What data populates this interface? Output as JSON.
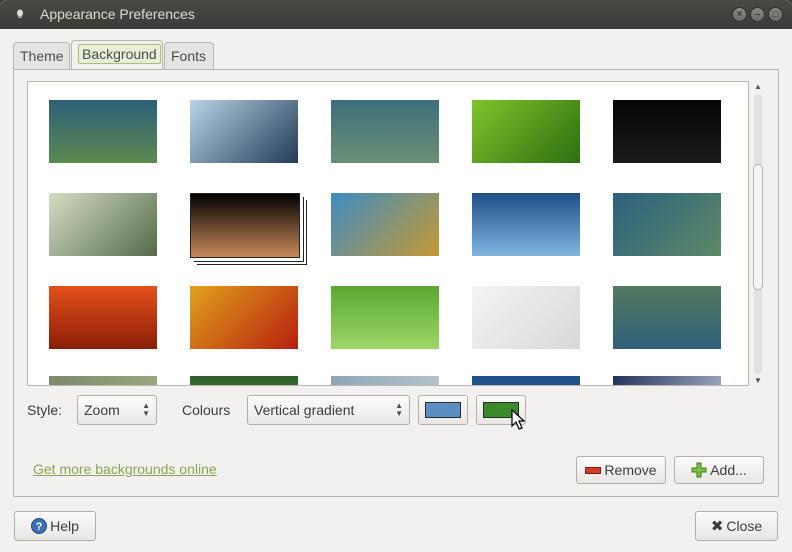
{
  "window": {
    "title": "Appearance Preferences",
    "controls": [
      "close",
      "minimize",
      "maximize"
    ]
  },
  "tabs": [
    {
      "label": "Theme",
      "active": false
    },
    {
      "label": "Background",
      "active": true
    },
    {
      "label": "Fonts",
      "active": false
    }
  ],
  "gallery": {
    "wallpapers": [
      {
        "name": "blue-green-gradient",
        "colors": [
          "#2e5f7a",
          "#5b8a4e"
        ]
      },
      {
        "name": "water-drop",
        "colors": [
          "#b9d4e6",
          "#223b57"
        ]
      },
      {
        "name": "misty-blue-green",
        "colors": [
          "#3d6f7d",
          "#6b8f75"
        ]
      },
      {
        "name": "green-leaf",
        "colors": [
          "#7fc52b",
          "#2f6d10"
        ]
      },
      {
        "name": "dark-abstract",
        "colors": [
          "#050505",
          "#1b1b1b"
        ]
      },
      {
        "name": "green-swirl",
        "colors": [
          "#d4ddc4",
          "#54694a"
        ]
      },
      {
        "name": "jupiter",
        "colors": [
          "#000000",
          "#c98a5a"
        ],
        "selected": true
      },
      {
        "name": "grass-sky",
        "colors": [
          "#3f8cc2",
          "#c49a33"
        ]
      },
      {
        "name": "blue-bubbles",
        "colors": [
          "#1d4f86",
          "#7fb6e0"
        ]
      },
      {
        "name": "teal-dots",
        "colors": [
          "#2c5f7d",
          "#5c8a68"
        ]
      },
      {
        "name": "orange-flower",
        "colors": [
          "#e5501a",
          "#8a1e08"
        ]
      },
      {
        "name": "red-flower-bokeh",
        "colors": [
          "#e0a21c",
          "#b81e10"
        ]
      },
      {
        "name": "green-grass",
        "colors": [
          "#5aa731",
          "#9dd766"
        ]
      },
      {
        "name": "white-logo",
        "colors": [
          "#f4f4f4",
          "#d8d8d8"
        ]
      },
      {
        "name": "green-blue-wave",
        "colors": [
          "#55785f",
          "#2e5f7a"
        ]
      },
      {
        "name": "partial-1",
        "colors": [
          "#7a8a6a",
          "#a7b58c"
        ]
      },
      {
        "name": "partial-2",
        "colors": [
          "#2d5f2a",
          "#6fa65a"
        ]
      },
      {
        "name": "partial-3",
        "colors": [
          "#8ea4b5",
          "#c7d2d8"
        ]
      },
      {
        "name": "partial-4",
        "colors": [
          "#1f4f86",
          "#2e6aa8"
        ]
      },
      {
        "name": "partial-5",
        "colors": [
          "#1e2f5a",
          "#d6dcea"
        ]
      }
    ]
  },
  "controls": {
    "style_label": "Style:",
    "style_value": "Zoom",
    "colours_label": "Colours",
    "colours_value": "Vertical gradient",
    "primary_color": "#5b8fc4",
    "secondary_color": "#3a8a2a"
  },
  "links": {
    "more_backgrounds": "Get more backgrounds online"
  },
  "buttons": {
    "remove": "Remove",
    "add": "Add...",
    "help": "Help",
    "close": "Close"
  }
}
